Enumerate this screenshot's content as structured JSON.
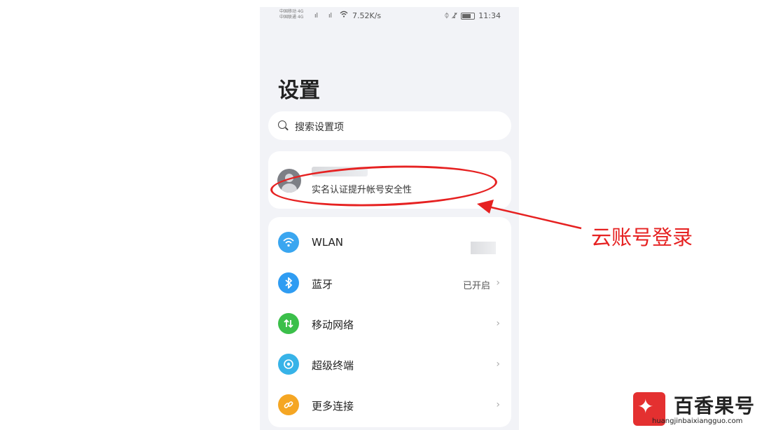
{
  "status": {
    "carrier_line1": "中国移动 4G",
    "carrier_line2": "中国联通 4G",
    "signal1": "ıl",
    "signal2": "ıl",
    "speed": "7.52K/s",
    "time": "11:34"
  },
  "page": {
    "title": "设置",
    "search_placeholder": "搜索设置项"
  },
  "account": {
    "subtitle": "实名认证提升帐号安全性"
  },
  "rows": [
    {
      "label": "WLAN",
      "value": "",
      "color": "#3aa6f0",
      "icon": "wifi-icon"
    },
    {
      "label": "蓝牙",
      "value": "已开启",
      "color": "#2f9cf2",
      "icon": "bluetooth-icon"
    },
    {
      "label": "移动网络",
      "value": "",
      "color": "#3bbf4a",
      "icon": "mobile-network-icon"
    },
    {
      "label": "超级终端",
      "value": "",
      "color": "#37b3e8",
      "icon": "super-device-icon"
    },
    {
      "label": "更多连接",
      "value": "",
      "color": "#f5a623",
      "icon": "link-icon"
    }
  ],
  "annotation": {
    "text": "云账号登录",
    "color": "#e62121"
  },
  "watermark": {
    "name": "百香果号",
    "url": "huangjinbaixiangguo.com"
  }
}
